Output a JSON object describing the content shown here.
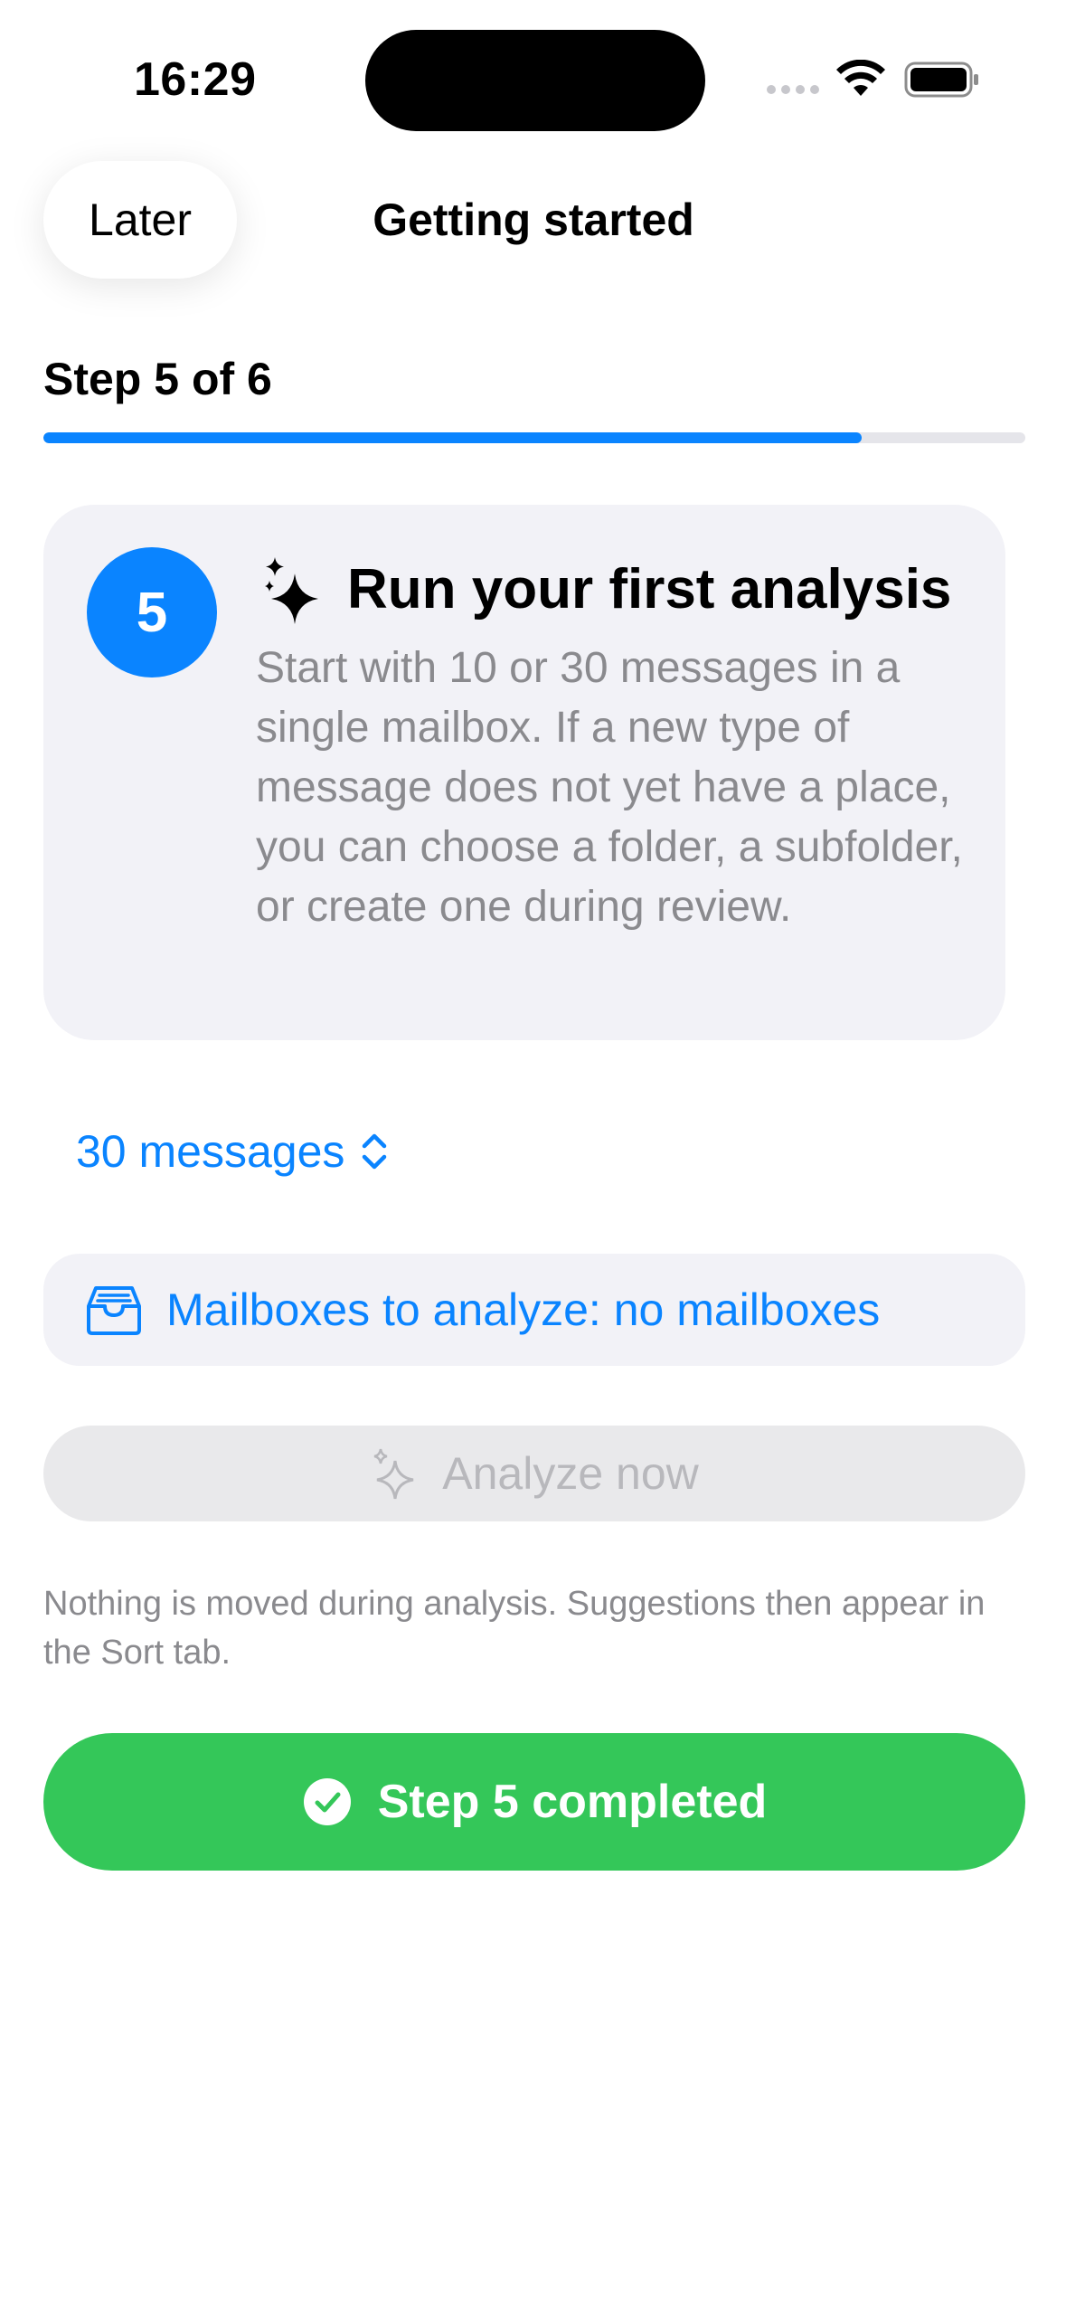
{
  "status_bar": {
    "time": "16:29"
  },
  "nav": {
    "later_label": "Later",
    "title": "Getting started"
  },
  "progress": {
    "label": "Step 5 of 6",
    "fraction": 0.833
  },
  "card": {
    "step_number": "5",
    "title": "Run your first analysis",
    "body": "Start with 10 or 30 messages in a single mailbox. If a new type of message does not yet have a place, you can choose a folder, a subfolder, or create one during review.",
    "icon": "sparkles-icon"
  },
  "count_select": {
    "value": "30 messages",
    "icon": "chevron-up-down-icon"
  },
  "mailboxes": {
    "label": "Mailboxes to analyze: no mailboxes",
    "icon": "tray-icon"
  },
  "analyze": {
    "label": "Analyze now",
    "icon": "sparkles-icon",
    "enabled": false
  },
  "footnote": "Nothing is moved during analysis. Suggestions then appear in the Sort tab.",
  "complete": {
    "label": "Step 5 completed",
    "icon": "checkmark-circle-icon"
  },
  "colors": {
    "accent": "#0a84ff",
    "success": "#34c759",
    "card_bg": "#f2f2f7",
    "secondary_text": "#8a8a8e"
  }
}
